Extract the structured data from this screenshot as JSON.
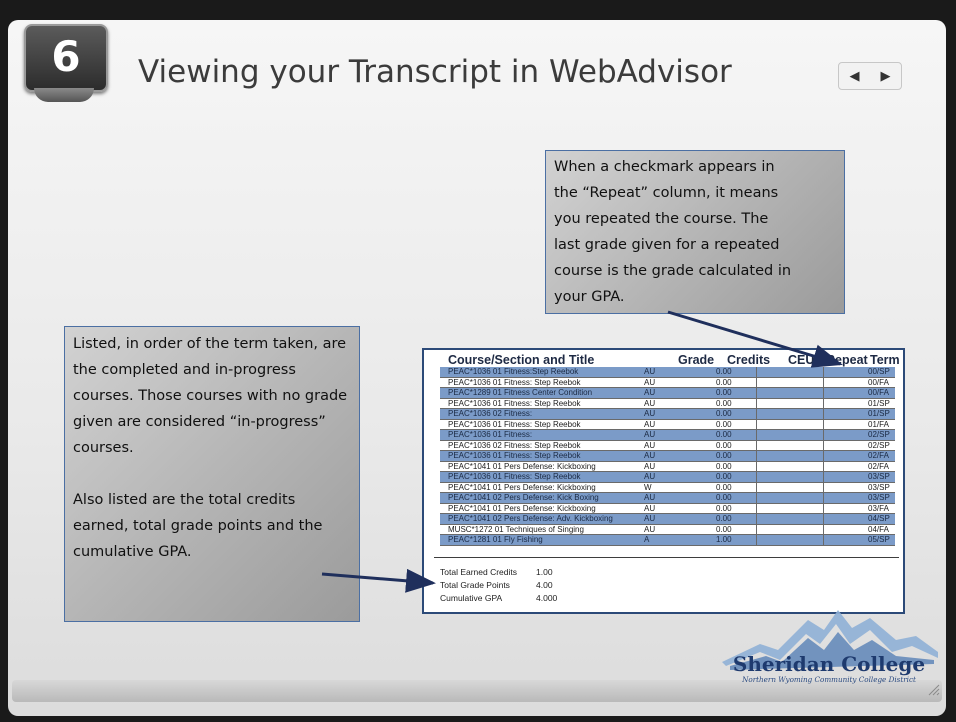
{
  "slide": {
    "number": "6",
    "title": "Viewing your Transcript in WebAdvisor",
    "nav": {
      "prev": "◀",
      "next": "▶"
    }
  },
  "callout_right": {
    "lines": [
      "When a checkmark appears in",
      "the “Repeat” column, it means",
      "you repeated the course. The",
      "last grade given for a repeated",
      "course is the grade calculated in",
      "your GPA."
    ]
  },
  "callout_left": {
    "paragraph_1": "Listed, in order of the term taken, are the completed and in-progress courses. Those courses with no grade given are considered “in-progress” courses.",
    "paragraph_2": "Also listed are the total credits earned, total grade points and the cumulative GPA."
  },
  "transcript": {
    "headers": {
      "course": "Course/Section and Title",
      "grade": "Grade",
      "credits": "Credits",
      "ceus": "CEUs",
      "repeat": "Repeat",
      "term": "Term"
    },
    "rows": [
      {
        "course": "PEAC*1036 01 Fitness:Step Reebok",
        "grade": "AU",
        "credits": "0.00",
        "term": "00/SP"
      },
      {
        "course": "PEAC*1036 01 Fitness: Step Reebok",
        "grade": "AU",
        "credits": "0.00",
        "term": "00/FA"
      },
      {
        "course": "PEAC*1289 01 Fitness Center Condition",
        "grade": "AU",
        "credits": "0.00",
        "term": "00/FA"
      },
      {
        "course": "PEAC*1036 01 Fitness: Step Reebok",
        "grade": "AU",
        "credits": "0.00",
        "term": "01/SP"
      },
      {
        "course": "PEAC*1036 02 Fitness:",
        "grade": "AU",
        "credits": "0.00",
        "term": "01/SP"
      },
      {
        "course": "PEAC*1036 01 Fitness: Step Reebok",
        "grade": "AU",
        "credits": "0.00",
        "term": "01/FA"
      },
      {
        "course": "PEAC*1036 01 Fitness:",
        "grade": "AU",
        "credits": "0.00",
        "term": "02/SP"
      },
      {
        "course": "PEAC*1036 02 Fitness: Step Reebok",
        "grade": "AU",
        "credits": "0.00",
        "term": "02/SP"
      },
      {
        "course": "PEAC*1036 01 Fitness: Step Reebok",
        "grade": "AU",
        "credits": "0.00",
        "term": "02/FA"
      },
      {
        "course": "PEAC*1041 01 Pers Defense: Kickboxing",
        "grade": "AU",
        "credits": "0.00",
        "term": "02/FA"
      },
      {
        "course": "PEAC*1036 01 Fitness: Step Reebok",
        "grade": "AU",
        "credits": "0.00",
        "term": "03/SP"
      },
      {
        "course": "PEAC*1041 01 Pers Defense: Kickboxing",
        "grade": "W",
        "credits": "0.00",
        "term": "03/SP"
      },
      {
        "course": "PEAC*1041 02 Pers Defense: Kick Boxing",
        "grade": "AU",
        "credits": "0.00",
        "term": "03/SP"
      },
      {
        "course": "PEAC*1041 01 Pers Defense: Kickboxing",
        "grade": "AU",
        "credits": "0.00",
        "term": "03/FA"
      },
      {
        "course": "PEAC*1041 02 Pers Defense: Adv. Kickboxing",
        "grade": "AU",
        "credits": "0.00",
        "term": "04/SP"
      },
      {
        "course": "MUSC*1272 01 Techniques of Singing",
        "grade": "AU",
        "credits": "0.00",
        "term": "04/FA"
      },
      {
        "course": "PEAC*1281 01 Fly Fishing",
        "grade": "A",
        "credits": "1.00",
        "term": "05/SP"
      }
    ],
    "totals": [
      {
        "label": "Total Earned Credits",
        "value": "1.00"
      },
      {
        "label": "Total Grade Points",
        "value": "4.00"
      },
      {
        "label": "Cumulative GPA",
        "value": "4.000"
      }
    ]
  },
  "logo": {
    "name": "Sheridan College",
    "tagline": "Northern Wyoming Community College District"
  },
  "colors": {
    "row_highlight": "#7b9bc8",
    "callout_border": "#4b6fa3",
    "arrow": "#1f2f5c",
    "logo_text": "#1e3a6e",
    "mountain": "#8fb0d6"
  }
}
